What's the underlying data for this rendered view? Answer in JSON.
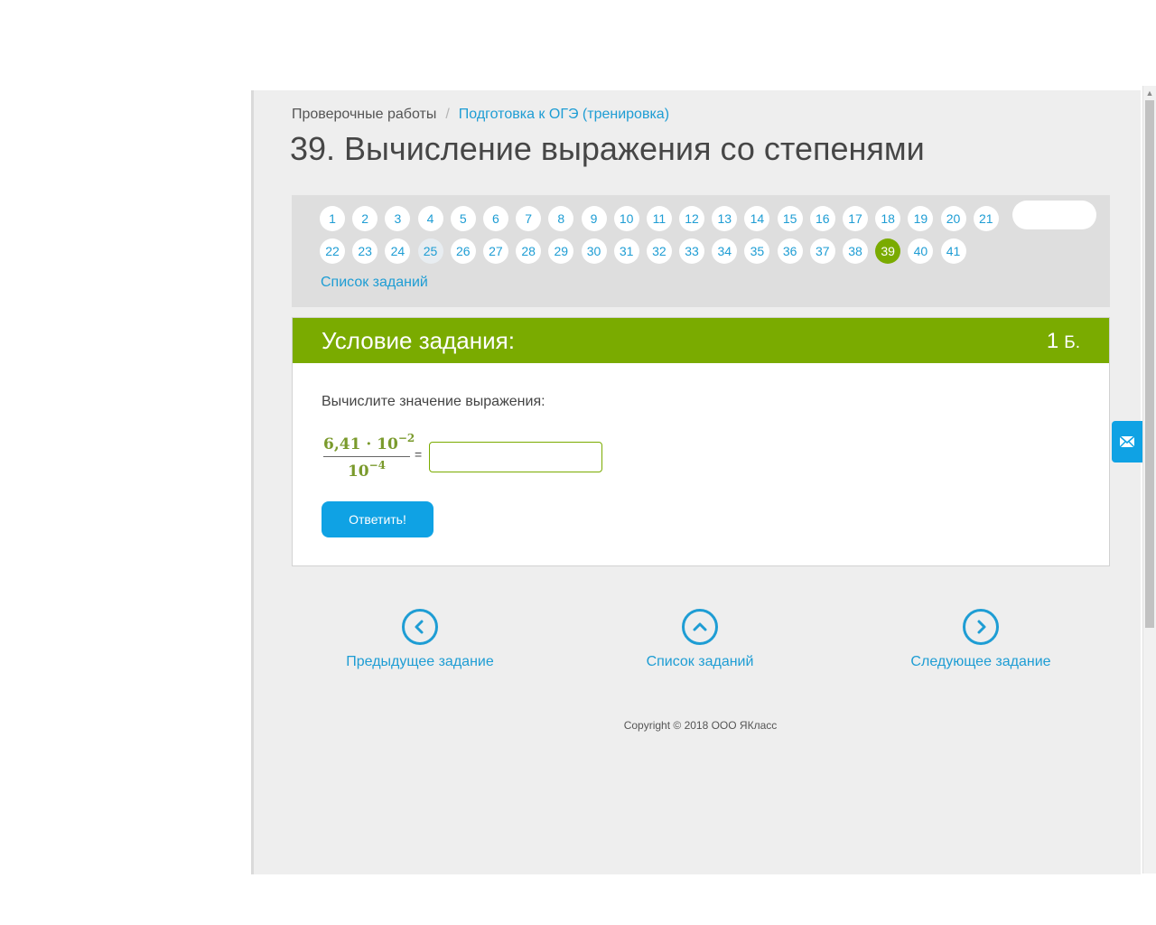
{
  "breadcrumb": {
    "root": "Проверочные работы",
    "separator": "/",
    "current": "Подготовка к ОГЭ (тренировка)"
  },
  "title": "39. Вычисление выражения со степенями",
  "task_nav": {
    "row1": [
      "1",
      "2",
      "3",
      "4",
      "5",
      "6",
      "7",
      "8",
      "9",
      "10",
      "11",
      "12",
      "13",
      "14",
      "15",
      "16",
      "17",
      "18",
      "19",
      "20",
      "21"
    ],
    "row2": [
      "22",
      "23",
      "24",
      "25",
      "26",
      "27",
      "28",
      "29",
      "30",
      "31",
      "32",
      "33",
      "34",
      "35",
      "36",
      "37",
      "38",
      "39",
      "40",
      "41"
    ],
    "active": "39",
    "visited": [
      "25"
    ],
    "list_link": "Список заданий"
  },
  "task": {
    "header": "Условие задания:",
    "points_value": "1",
    "points_unit": "Б.",
    "text": "Вычислите значение выражения:",
    "expression": {
      "numerator_base": "6,41 · 10",
      "numerator_exp": "−2",
      "denominator_base": "10",
      "denominator_exp": "−4",
      "equals": "="
    },
    "answer_value": "",
    "submit_label": "Ответить!"
  },
  "bottom_nav": {
    "prev_label": "Предыдущее задание",
    "list_label": "Список заданий",
    "next_label": "Следующее задание"
  },
  "copyright": "Copyright © 2018 ООО ЯКласс",
  "icons": {
    "prev": "chevron-left-circle-icon",
    "list": "chevron-up-circle-icon",
    "next": "chevron-right-circle-icon",
    "feedback": "envelope-icon",
    "scroll_up": "scroll-up-arrow-icon"
  },
  "colors": {
    "accent_green": "#7aab00",
    "link_blue": "#1e9dd4",
    "button_blue": "#0fa2e4"
  }
}
